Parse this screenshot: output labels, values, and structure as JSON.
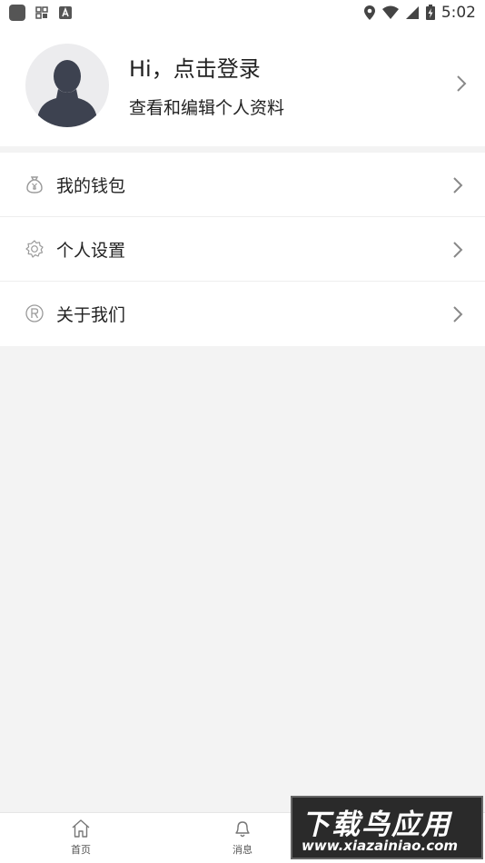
{
  "status_bar": {
    "time": "5:02"
  },
  "profile": {
    "title": "Hi，点击登录",
    "subtitle": "查看和编辑个人资料"
  },
  "menu": {
    "items": [
      {
        "label": "我的钱包",
        "icon": "wallet-icon"
      },
      {
        "label": "个人设置",
        "icon": "gear-icon"
      },
      {
        "label": "关于我们",
        "icon": "registered-icon"
      }
    ]
  },
  "tabs": [
    {
      "label": "首页",
      "icon": "home-icon"
    },
    {
      "label": "消息",
      "icon": "bell-icon"
    }
  ],
  "watermark": {
    "title": "下载鸟应用",
    "url": "www.xiazainiao.com"
  },
  "colors": {
    "icon_gray": "#9a9a9a",
    "avatar_silhouette": "#3d4250",
    "avatar_bg": "#ececee"
  }
}
